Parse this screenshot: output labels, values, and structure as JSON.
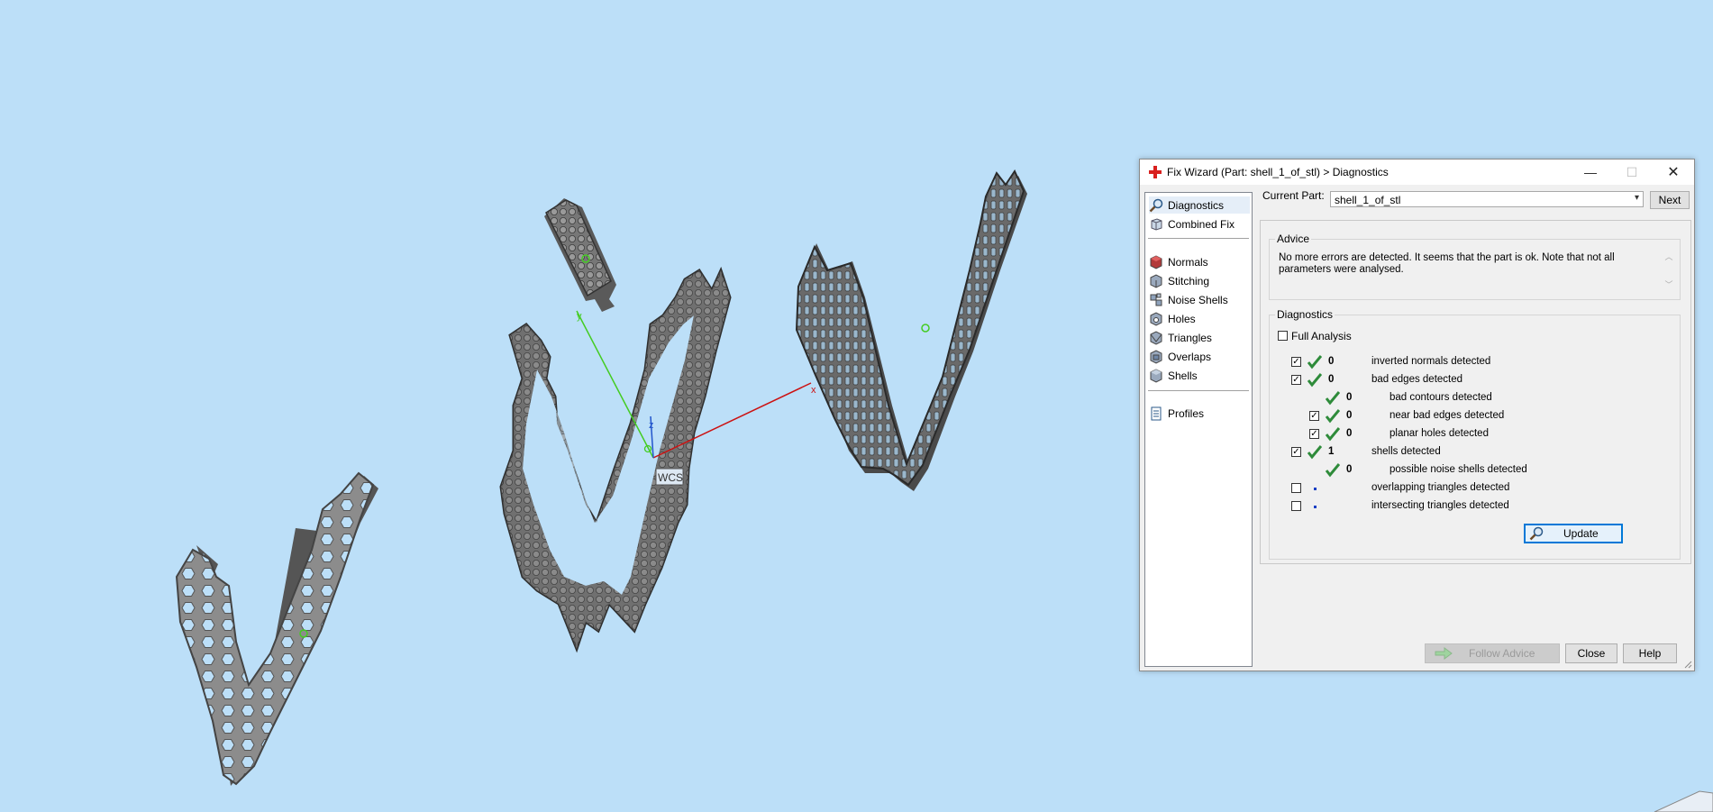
{
  "viewport": {
    "axis_labels": {
      "x": "x",
      "y": "y",
      "z": "z"
    },
    "wcs_label": "WCS",
    "colors": {
      "background": "#bcdff8",
      "part": "#8a8a8a",
      "x_axis": "#cc1111",
      "y_axis": "#44cc22",
      "z_axis": "#2255cc"
    }
  },
  "dialog": {
    "title": "Fix Wizard (Part: shell_1_of_stl) > Diagnostics",
    "window_buttons": {
      "minimize": "—",
      "maximize": "☐",
      "close": "✕"
    },
    "nav": {
      "items": [
        {
          "label": "Diagnostics",
          "icon": "magnifier-icon"
        },
        {
          "label": "Combined Fix",
          "icon": "cube-icon"
        },
        {
          "label": "Normals",
          "icon": "normals-cube-icon"
        },
        {
          "label": "Stitching",
          "icon": "stitching-cube-icon"
        },
        {
          "label": "Noise Shells",
          "icon": "noise-shells-icon"
        },
        {
          "label": "Holes",
          "icon": "holes-cube-icon"
        },
        {
          "label": "Triangles",
          "icon": "triangles-cube-icon"
        },
        {
          "label": "Overlaps",
          "icon": "overlaps-cube-icon"
        },
        {
          "label": "Shells",
          "icon": "shells-cube-icon"
        },
        {
          "label": "Profiles",
          "icon": "profiles-icon"
        }
      ]
    },
    "current_part": {
      "label": "Current Part:",
      "value": "shell_1_of_stl"
    },
    "next_label": "Next",
    "advice": {
      "title": "Advice",
      "text": "No more errors are detected. It seems that the part is ok. Note that not all parameters were analysed."
    },
    "diagnostics": {
      "title": "Diagnostics",
      "full_analysis_label": "Full Analysis",
      "full_analysis_checked": false,
      "rows": [
        {
          "checkbox": true,
          "checked": true,
          "status": "ok",
          "count": "0",
          "label": "inverted normals detected",
          "indent": 0
        },
        {
          "checkbox": true,
          "checked": true,
          "status": "ok",
          "count": "0",
          "label": "bad edges detected",
          "indent": 0
        },
        {
          "checkbox": false,
          "checked": false,
          "status": "ok",
          "count": "0",
          "label": "bad contours detected",
          "indent": 1
        },
        {
          "checkbox": true,
          "checked": true,
          "status": "ok",
          "count": "0",
          "label": "near bad edges detected",
          "indent": 1
        },
        {
          "checkbox": true,
          "checked": true,
          "status": "ok",
          "count": "0",
          "label": "planar holes detected",
          "indent": 1
        },
        {
          "checkbox": true,
          "checked": true,
          "status": "ok",
          "count": "1",
          "label": "shells detected",
          "indent": 0
        },
        {
          "checkbox": false,
          "checked": false,
          "status": "ok",
          "count": "0",
          "label": "possible noise shells detected",
          "indent": 1
        },
        {
          "checkbox": true,
          "checked": false,
          "status": "not-analysed",
          "count": "",
          "label": "overlapping triangles detected",
          "indent": 0
        },
        {
          "checkbox": true,
          "checked": false,
          "status": "not-analysed",
          "count": "",
          "label": "intersecting triangles detected",
          "indent": 0
        }
      ],
      "update_label": "Update"
    },
    "buttons": {
      "follow_advice": "Follow Advice",
      "close": "Close",
      "help": "Help"
    },
    "colors": {
      "check_green": "#2e8b3a",
      "accent": "#0078d7",
      "title_icon_red": "#d9201e"
    }
  }
}
